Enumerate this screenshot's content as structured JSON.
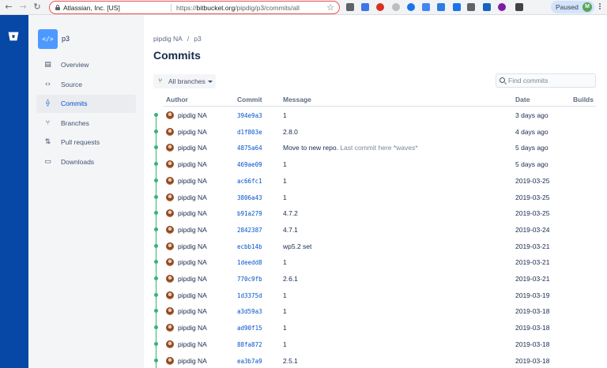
{
  "browser": {
    "site_identity": "Atlassian, Inc. [US]",
    "url_scheme": "https://",
    "url_domain": "bitbucket.org",
    "url_path": "/pipdig/p3/commits/all",
    "profile_status": "Paused",
    "profile_initial": "M",
    "extension_colors": [
      "#5f6368",
      "#3b78e7",
      "#d93025",
      "#bdbdbd",
      "#1a73e8",
      "#4285f4",
      "#2c7be5",
      "#1a73e8",
      "#5f6368",
      "#1565c0",
      "#7b1fa2",
      "#424242"
    ]
  },
  "repo": {
    "avatar_glyph": "</>",
    "name": "p3"
  },
  "sidebar": {
    "items": [
      {
        "label": "Overview",
        "icon": "overview-icon",
        "glyph": "▤"
      },
      {
        "label": "Source",
        "icon": "source-code-icon",
        "glyph": "‹›"
      },
      {
        "label": "Commits",
        "icon": "commit-icon",
        "glyph": "⟠",
        "active": true
      },
      {
        "label": "Branches",
        "icon": "branch-icon",
        "glyph": "⑂"
      },
      {
        "label": "Pull requests",
        "icon": "pull-request-icon",
        "glyph": "⇅"
      },
      {
        "label": "Downloads",
        "icon": "download-icon",
        "glyph": "▭"
      }
    ]
  },
  "breadcrumb": {
    "owner": "pipdig NA",
    "separator": "/",
    "repo": "p3"
  },
  "page_title": "Commits",
  "branch_filter": {
    "label": "All branches"
  },
  "search": {
    "placeholder": "Find commits"
  },
  "table": {
    "headers": {
      "author": "Author",
      "commit": "Commit",
      "message": "Message",
      "date": "Date",
      "builds": "Builds"
    },
    "rows": [
      {
        "author": "pipdig NA",
        "hash": "394e9a3",
        "message": "1",
        "message_extra": "",
        "date": "3 days ago"
      },
      {
        "author": "pipdig NA",
        "hash": "d1f803e",
        "message": "2.8.0",
        "message_extra": "",
        "date": "4 days ago"
      },
      {
        "author": "pipdig NA",
        "hash": "4875a64",
        "message": "Move to new repo.",
        "message_extra": "Last commit here *waves*",
        "date": "5 days ago"
      },
      {
        "author": "pipdig NA",
        "hash": "469ae09",
        "message": "1",
        "message_extra": "",
        "date": "5 days ago"
      },
      {
        "author": "pipdig NA",
        "hash": "ac66fc1",
        "message": "1",
        "message_extra": "",
        "date": "2019-03-25"
      },
      {
        "author": "pipdig NA",
        "hash": "3806a43",
        "message": "1",
        "message_extra": "",
        "date": "2019-03-25"
      },
      {
        "author": "pipdig NA",
        "hash": "b91a279",
        "message": "4.7.2",
        "message_extra": "",
        "date": "2019-03-25"
      },
      {
        "author": "pipdig NA",
        "hash": "2842387",
        "message": "4.7.1",
        "message_extra": "",
        "date": "2019-03-24"
      },
      {
        "author": "pipdig NA",
        "hash": "ecbb14b",
        "message": "wp5.2 set",
        "message_extra": "",
        "date": "2019-03-21"
      },
      {
        "author": "pipdig NA",
        "hash": "1deedd8",
        "message": "1",
        "message_extra": "",
        "date": "2019-03-21"
      },
      {
        "author": "pipdig NA",
        "hash": "770c9fb",
        "message": "2.6.1",
        "message_extra": "",
        "date": "2019-03-21"
      },
      {
        "author": "pipdig NA",
        "hash": "1d3375d",
        "message": "1",
        "message_extra": "",
        "date": "2019-03-19"
      },
      {
        "author": "pipdig NA",
        "hash": "a3d59a3",
        "message": "1",
        "message_extra": "",
        "date": "2019-03-18"
      },
      {
        "author": "pipdig NA",
        "hash": "ad90f15",
        "message": "1",
        "message_extra": "",
        "date": "2019-03-18"
      },
      {
        "author": "pipdig NA",
        "hash": "88fa872",
        "message": "1",
        "message_extra": "",
        "date": "2019-03-18"
      },
      {
        "author": "pipdig NA",
        "hash": "ea3b7a9",
        "message": "2.5.1",
        "message_extra": "",
        "date": "2019-03-18"
      }
    ]
  },
  "colors": {
    "global_nav": "#0747a6",
    "link": "#0052cc",
    "graph": "#36b37e"
  }
}
